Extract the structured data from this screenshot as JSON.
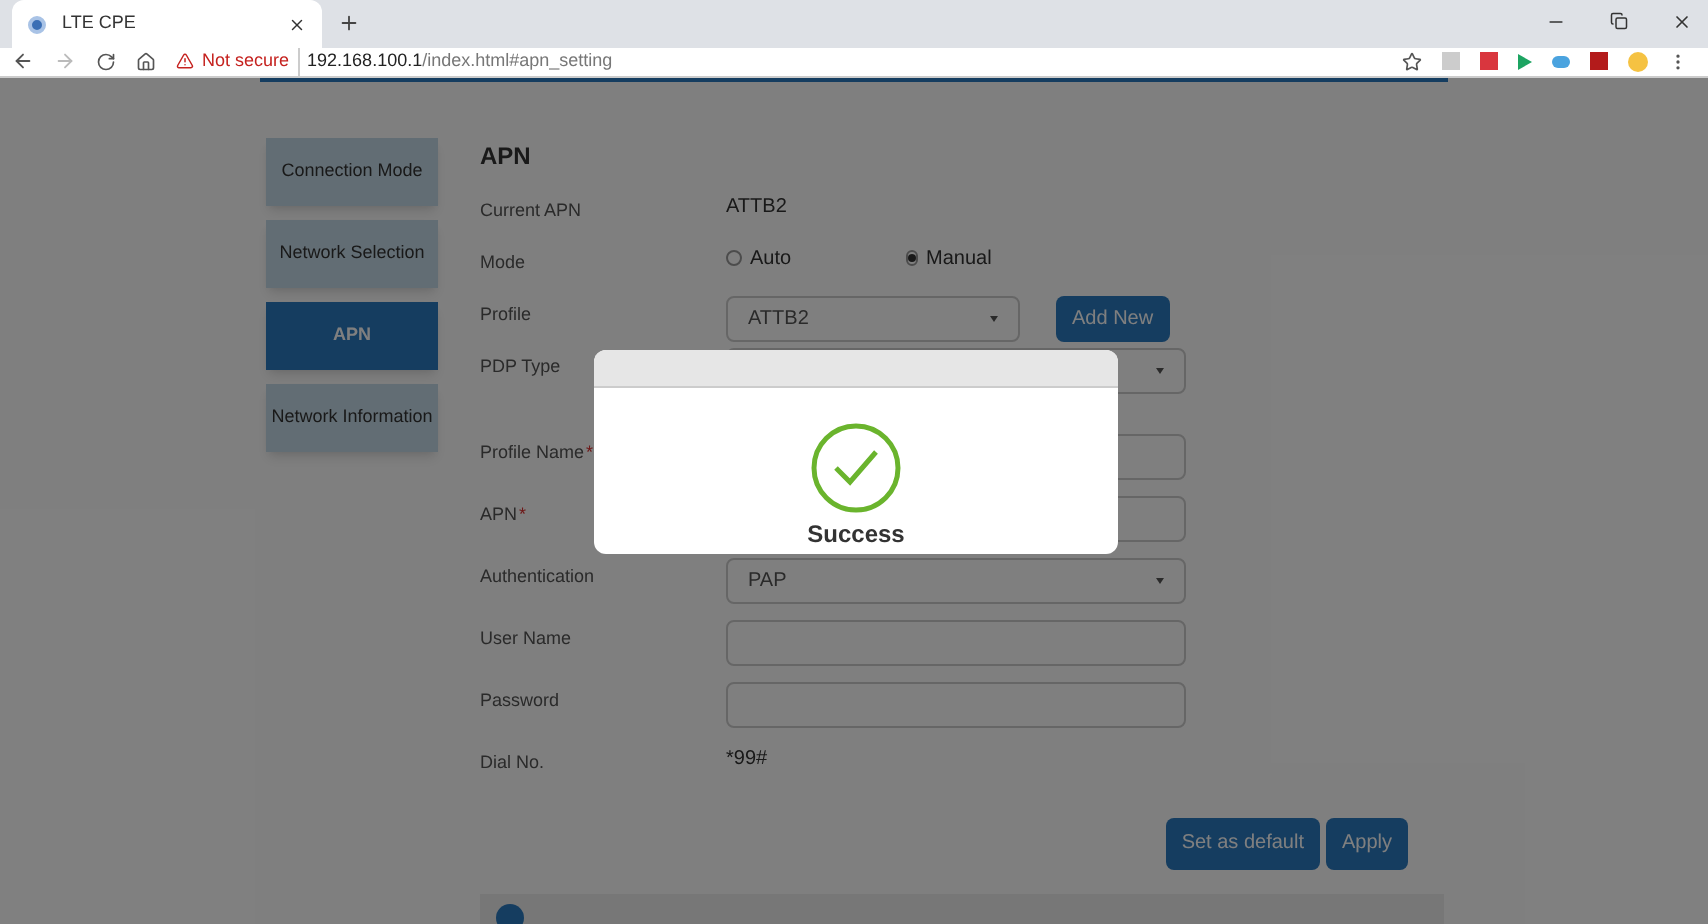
{
  "browser": {
    "tab_title": "LTE CPE",
    "security": "Not secure",
    "url_host": "192.168.100.1",
    "url_path": "/index.html#apn_setting"
  },
  "sidebar": {
    "items": [
      {
        "label": "Connection Mode",
        "selected": false
      },
      {
        "label": "Network Selection",
        "selected": false
      },
      {
        "label": "APN",
        "selected": true
      },
      {
        "label": "Network Information",
        "selected": false
      }
    ]
  },
  "form": {
    "title": "APN",
    "rows": [
      {
        "kind": "text",
        "label": "Current APN",
        "value": "ATTB2"
      },
      {
        "kind": "radio",
        "label": "Mode",
        "options": [
          {
            "label": "Auto",
            "selected": false
          },
          {
            "label": "Manual",
            "selected": true
          }
        ]
      },
      {
        "kind": "select",
        "label": "Profile",
        "value": "ATTB2",
        "button": "Add New"
      },
      {
        "kind": "select",
        "label": "PDP Type"
      },
      {
        "kind": "input",
        "label": "Profile Name",
        "required_mark": "*"
      },
      {
        "kind": "input",
        "label": "APN",
        "required_mark": "*"
      },
      {
        "kind": "select",
        "label": "Authentication",
        "value": "PAP"
      },
      {
        "kind": "input",
        "label": "User Name"
      },
      {
        "kind": "input",
        "label": "Password"
      },
      {
        "kind": "text",
        "label": "Dial No.",
        "value": "*99#"
      }
    ],
    "buttons": [
      "Set as default",
      "Apply"
    ]
  },
  "dialog": {
    "message": "Success"
  }
}
